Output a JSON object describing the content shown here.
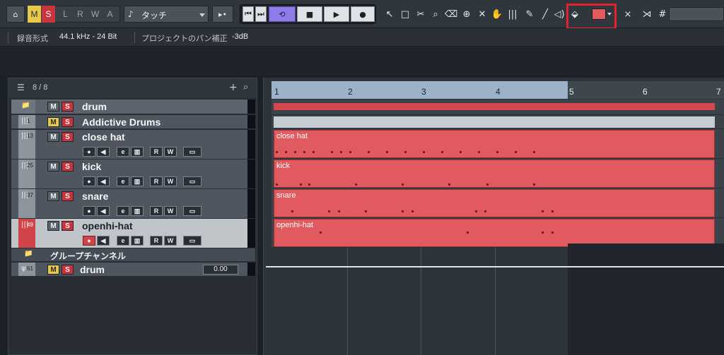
{
  "toolbar": {
    "msl": [
      "M",
      "S",
      "L",
      "R",
      "W",
      "A"
    ],
    "automation_mode": "タッチ",
    "colors": {
      "m_active": "#e6c84a",
      "s_active": "#c9343d",
      "loop_active": "#8e7be8",
      "color_swatch": "#e05a5f",
      "highlight_box": "#e8202a"
    }
  },
  "info": {
    "label1": "録音形式",
    "format": "44.1 kHz - 24 Bit",
    "label2": "プロジェクトのパン補正",
    "pan_law": "-3dB"
  },
  "trackpanel": {
    "count": "8 / 8",
    "tracks": [
      {
        "num": "",
        "name": "drum",
        "type": "folder",
        "mute_on": false
      },
      {
        "num": "1",
        "name": "Addictive Drums",
        "type": "instrument",
        "mute_on": true
      },
      {
        "num": "13",
        "name": "close hat",
        "type": "midi",
        "mute_on": false
      },
      {
        "num": "25",
        "name": "kick",
        "type": "midi",
        "mute_on": false
      },
      {
        "num": "37",
        "name": "snare",
        "type": "midi",
        "mute_on": false
      },
      {
        "num": "49",
        "name": "openhi-hat",
        "type": "midi",
        "mute_on": false,
        "selected": true
      },
      {
        "num": "",
        "name": "グループチャンネル",
        "type": "group-folder"
      },
      {
        "num": "61",
        "name": "drum",
        "type": "group",
        "mute_on": true,
        "volume": "0.00"
      }
    ],
    "btn_m": "M",
    "btn_s": "S",
    "ctl_r": "R",
    "ctl_w": "W",
    "ctl_e": "e"
  },
  "ruler": {
    "bars": [
      "1",
      "2",
      "3",
      "4",
      "5",
      "6",
      "7"
    ]
  },
  "parts": {
    "closehat": "close hat",
    "kick": "kick",
    "snare": "snare",
    "openhat": "openhi-hat"
  }
}
